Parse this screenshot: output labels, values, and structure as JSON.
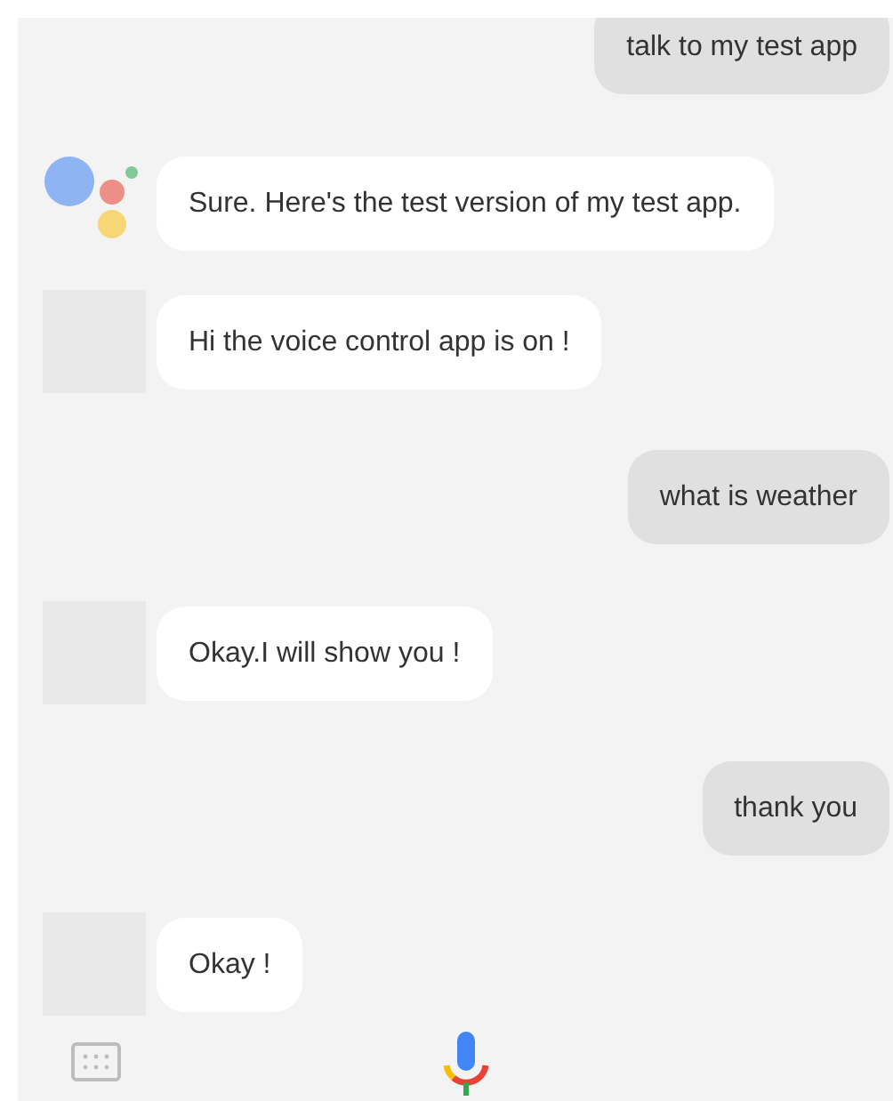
{
  "messages": [
    {
      "kind": "user",
      "text": "talk to my test app"
    },
    {
      "kind": "assistant",
      "logo": true,
      "text": "Sure. Here's the test version of my test app."
    },
    {
      "kind": "assistant",
      "logo": false,
      "text": "Hi the voice control app is on !"
    },
    {
      "kind": "user",
      "text": "what is weather"
    },
    {
      "kind": "assistant",
      "logo": false,
      "text": "Okay.I will show you !"
    },
    {
      "kind": "user",
      "text": "thank you"
    },
    {
      "kind": "assistant",
      "logo": false,
      "text": "Okay !"
    }
  ]
}
